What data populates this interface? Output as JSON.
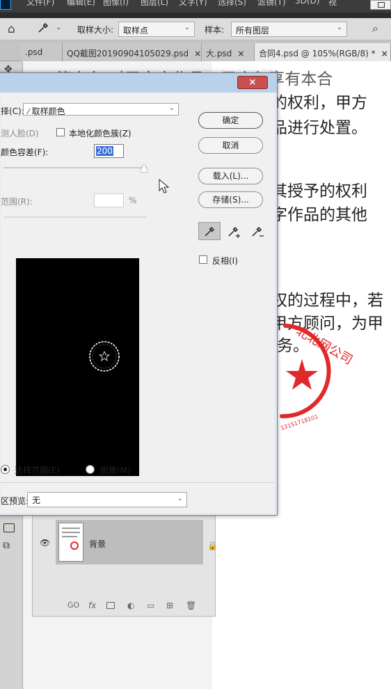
{
  "menubar": {
    "items": [
      "文件(F)",
      "编辑(E)",
      "图像(I)",
      "图层(L)",
      "文字(Y)",
      "选择(S)",
      "滤镜(T)",
      "3D(D)",
      "视"
    ]
  },
  "options_bar": {
    "sample_size_label": "取样大小:",
    "sample_size_value": "取样点",
    "sample_label": "样本:",
    "sample_value": "所有图层"
  },
  "tabs": [
    {
      "label": ".psd",
      "close": "×"
    },
    {
      "label": "QQ截图20190904105029.psd",
      "close": "×"
    },
    {
      "label": "大.psd",
      "close": "×"
    },
    {
      "label": "合同4.psd @ 105%(RGB/8) *",
      "close": "×"
    }
  ],
  "document": {
    "lines": [
      "第六条 对于文字作品，甲方仅享有本合",
      "的权利，甲方",
      "品进行处置。",
      "其授予的权利",
      "字作品的其他",
      "权的过程中，若",
      "甲方顾问，为甲",
      "务。"
    ],
    "stamp_text": "北北网公司",
    "stamp_number": "13151718101"
  },
  "dialog": {
    "close_label": "×",
    "select_label": "择(C):",
    "select_value": "取样颜色",
    "face_label": "测人脸(D)",
    "localized_label": "本地化颜色簇(Z)",
    "fuzziness_label": "颜色容差(F):",
    "fuzziness_value": "200",
    "range_label": "范围(R):",
    "range_unit": "%",
    "ok_button": "确定",
    "cancel_button": "取消",
    "load_button": "载入(L)...",
    "save_button": "存储(S)...",
    "invert_label": "反相(I)",
    "radio_selection": "选择范围(E)",
    "radio_image": "图像(M)",
    "preview_label": "区预览:",
    "preview_value": "无"
  },
  "layers": {
    "background_name": "背景",
    "footer_icons": [
      "GO",
      "fx"
    ]
  }
}
